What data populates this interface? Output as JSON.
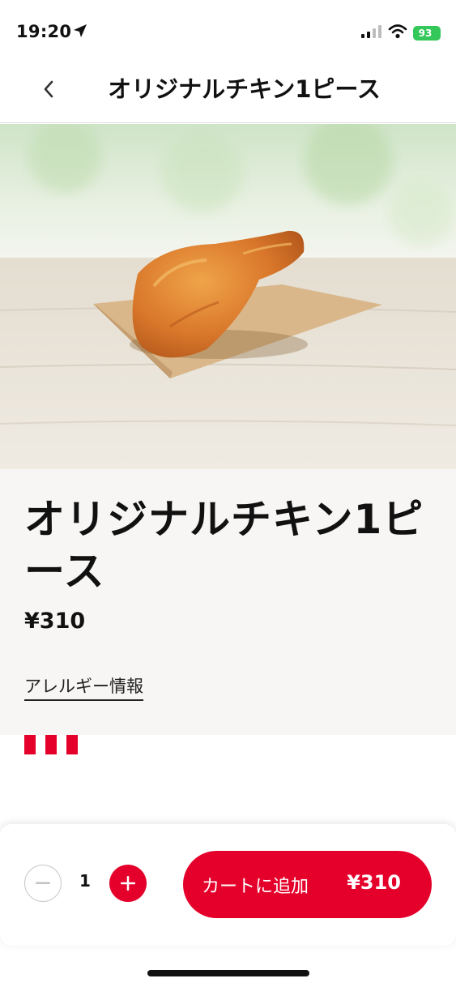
{
  "status_bar": {
    "time": "19:20",
    "battery": "93",
    "icons": [
      "location-arrow-icon",
      "signal-icon",
      "wifi-icon",
      "battery-charging-icon"
    ]
  },
  "header": {
    "title": "オリジナルチキン1ピース",
    "back_icon": "chevron-left-icon"
  },
  "product": {
    "name": "オリジナルチキン1ピース",
    "price": "¥310",
    "allergy_link": "アレルギー情報"
  },
  "cart": {
    "quantity": "1",
    "add_label": "カートに追加",
    "add_price": "¥310",
    "minus_icon": "minus-icon",
    "plus_icon": "plus-icon"
  },
  "colors": {
    "brand_red": "#e4002b",
    "battery_green": "#34c759",
    "info_background": "#f7f6f4"
  }
}
